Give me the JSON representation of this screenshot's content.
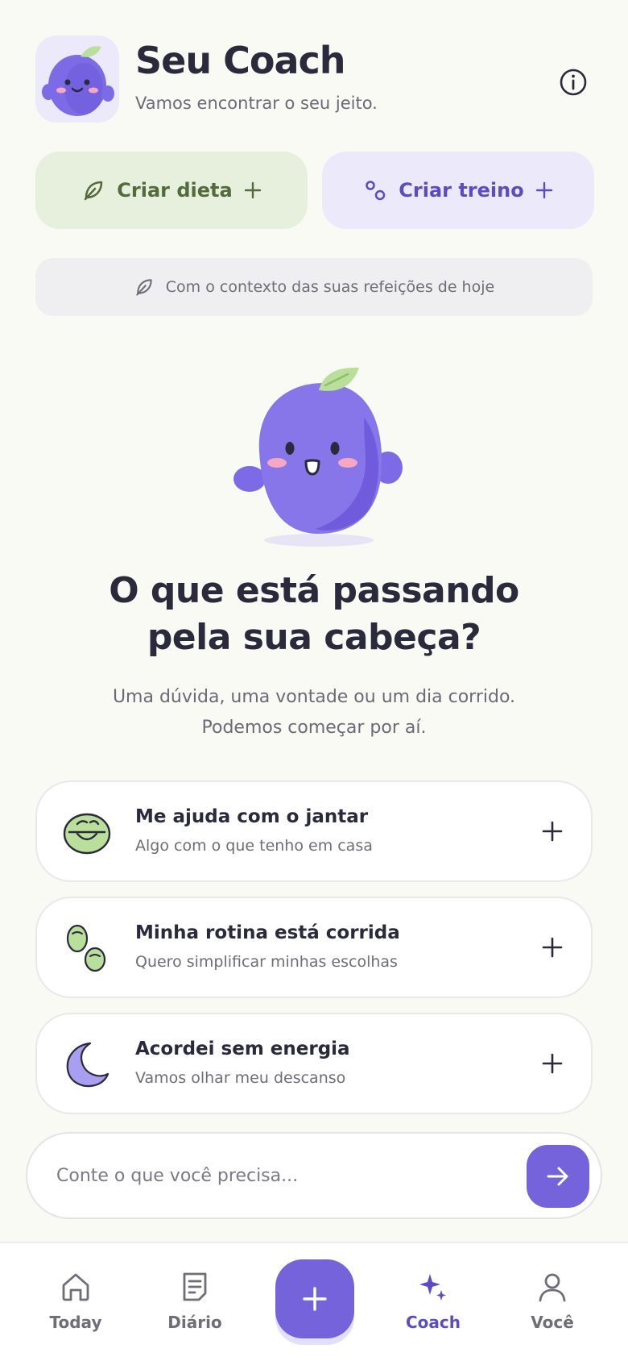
{
  "header": {
    "title": "Seu Coach",
    "subtitle": "Vamos encontrar o seu jeito."
  },
  "actions": {
    "diet_label": "Criar dieta",
    "train_label": "Criar treino"
  },
  "context": {
    "text": "Com o contexto das suas refeições de hoje"
  },
  "hero": {
    "title_line1": "O que está passando",
    "title_line2": "pela sua cabeça?",
    "subtitle_line1": "Uma dúvida, uma vontade ou um dia corrido.",
    "subtitle_line2": "Podemos começar por aí."
  },
  "suggestions": [
    {
      "title": "Me ajuda com o jantar",
      "subtitle": "Algo com o que tenho em casa",
      "icon": "bowl-face-icon"
    },
    {
      "title": "Minha rotina está corrida",
      "subtitle": "Quero simplificar minhas escolhas",
      "icon": "peas-icon"
    },
    {
      "title": "Acordei sem energia",
      "subtitle": "Vamos olhar meu descanso",
      "icon": "moon-icon"
    }
  ],
  "composer": {
    "placeholder": "Conte o que você precisa..."
  },
  "nav": {
    "today": "Today",
    "diario": "Diário",
    "coach": "Coach",
    "voce": "Você",
    "active": "coach"
  },
  "colors": {
    "background": "#f9faf3",
    "accent": "#7563dc",
    "accent_text": "#5c4bc4",
    "diet_bg": "#e7f0dc",
    "diet_text": "#536a3c",
    "train_bg": "#ece9fb"
  }
}
